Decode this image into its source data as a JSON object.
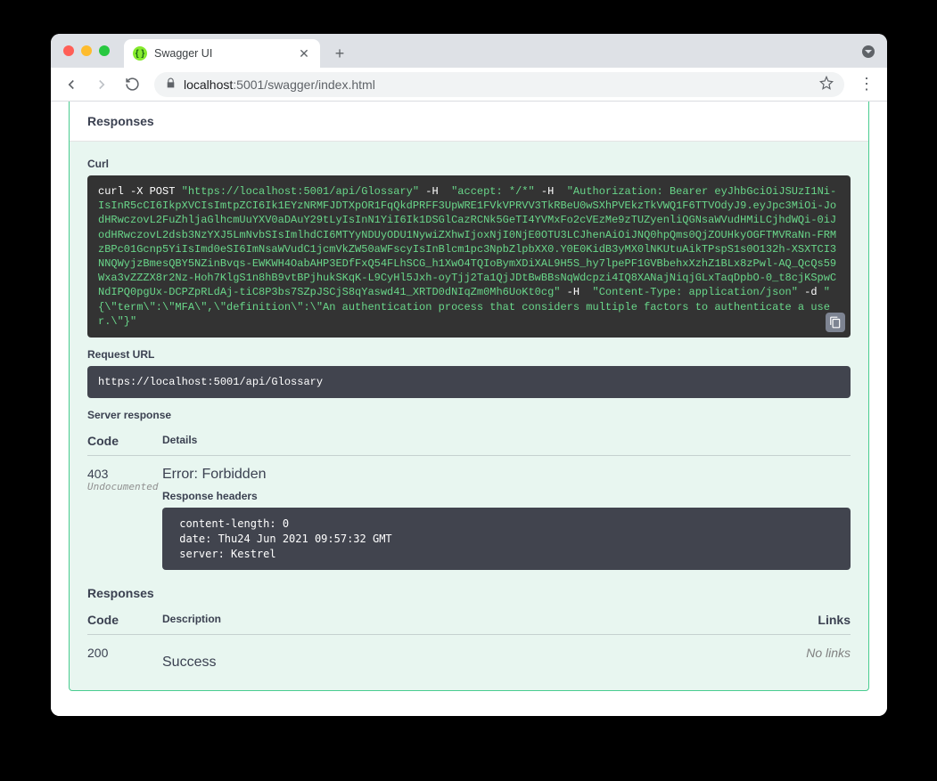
{
  "browser": {
    "tab_title": "Swagger UI",
    "url_host": "localhost",
    "url_port_path": ":5001/swagger/index.html"
  },
  "labels": {
    "responses_top": "Responses",
    "curl": "Curl",
    "request_url": "Request URL",
    "server_response": "Server response",
    "code": "Code",
    "details": "Details",
    "description": "Description",
    "links": "Links",
    "response_headers": "Response headers",
    "responses_bottom": "Responses"
  },
  "curl": {
    "p1": "curl -X POST ",
    "p2": "\"https://localhost:5001/api/Glossary\"",
    "p3": " -H  ",
    "p4": "\"accept: */*\"",
    "p5": " -H  ",
    "p6": "\"Authorization: Bearer eyJhbGciOiJSUzI1Ni-IsInR5cCI6IkpXVCIsImtpZCI6Ik1EYzNRMFJDTXpOR1FqQkdPRFF3UpWRE1FVkVPRVV3TkRBeU0wSXhPVEkzTkVWQ1F6TTVOdyJ9.eyJpc3MiOi-JodHRwczovL2FuZhljaGlhcmUuYXV0aDAuY29tLyIsInN1YiI6Ik1DSGlCazRCNk5GeTI4YVMxFo2cVEzMe9zTUZyenliQGNsaWVudHMiLCjhdWQi-0iJodHRwczovL2dsb3NzYXJ5LmNvbSIsImlhdCI6MTYyNDUyODU1NywiZXhwIjoxNjI0NjE0OTU3LCJhenAiOiJNQ0hpQms0QjZOUHkyOGFTMVRaNn-FRMzBPc01Gcnp5YiIsImd0eSI6ImNsaWVudC1jcmVkZW50aWFscyIsInBlcm1pc3NpbZlpbXX0.Y0E0KidB3yMX0lNKUtuAikTPspS1s0O132h-XSXTCI3NNQWyjzBmesQBY5NZinBvqs-EWKWH4OabAHP3EDfFxQ54FLhSCG_h1XwO4TQIoBymXDiXAL9H5S_hy7lpePF1GVBbehxXzhZ1BLx8zPwl-AQ_QcQs59Wxa3vZZZX8r2Nz-Hoh7KlgS1n8hB9vtBPjhukSKqK-L9CyHl5Jxh-oyTjj2Ta1QjJDtBwBBsNqWdcpzi4IQ8XANajNiqjGLxTaqDpbO-0_t8cjKSpwCNdIPQ0pgUx-DCPZpRLdAj-tiC8P3bs7SZpJSCjS8qYaswd41_XRTD0dNIqZm0Mh6UoKt0cg\"",
    "p7": " -H  ",
    "p8": "\"Content-Type: application/json\"",
    "p9": " -d ",
    "p10": "\"{\\\"term\\\":\\\"MFA\\\",\\\"definition\\\":\\\"An authentication process that considers multiple factors to authenticate a user.\\\"}\""
  },
  "request_url_value": "https://localhost:5001/api/Glossary",
  "server_response": {
    "code": "403",
    "undocumented": "Undocumented",
    "error": "Error: Forbidden",
    "headers": " content-length: 0 \n date: Thu24 Jun 2021 09:57:32 GMT \n server: Kestrel "
  },
  "documented": {
    "code": "200",
    "description": "Success",
    "links": "No links"
  }
}
